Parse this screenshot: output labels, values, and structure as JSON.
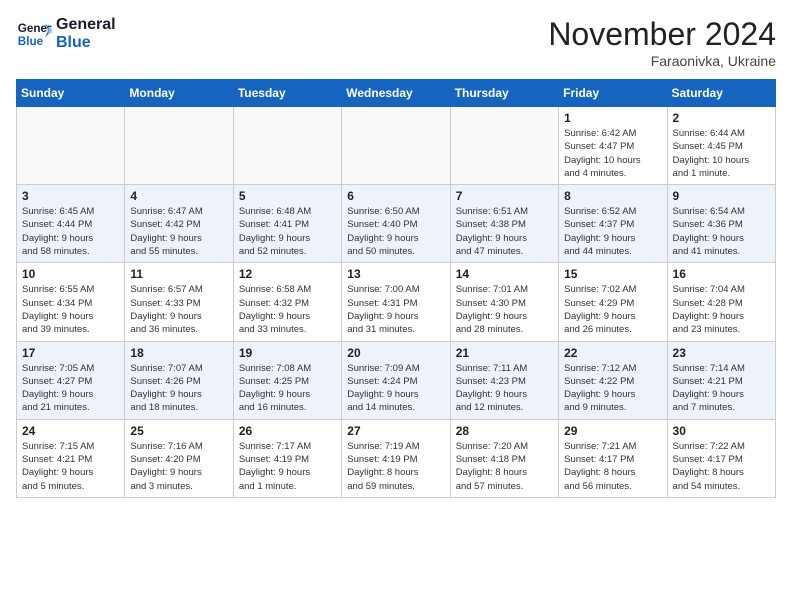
{
  "header": {
    "logo_line1": "General",
    "logo_line2": "Blue",
    "month_title": "November 2024",
    "location": "Faraonivka, Ukraine"
  },
  "weekdays": [
    "Sunday",
    "Monday",
    "Tuesday",
    "Wednesday",
    "Thursday",
    "Friday",
    "Saturday"
  ],
  "weeks": [
    [
      {
        "day": "",
        "info": ""
      },
      {
        "day": "",
        "info": ""
      },
      {
        "day": "",
        "info": ""
      },
      {
        "day": "",
        "info": ""
      },
      {
        "day": "",
        "info": ""
      },
      {
        "day": "1",
        "info": "Sunrise: 6:42 AM\nSunset: 4:47 PM\nDaylight: 10 hours\nand 4 minutes."
      },
      {
        "day": "2",
        "info": "Sunrise: 6:44 AM\nSunset: 4:45 PM\nDaylight: 10 hours\nand 1 minute."
      }
    ],
    [
      {
        "day": "3",
        "info": "Sunrise: 6:45 AM\nSunset: 4:44 PM\nDaylight: 9 hours\nand 58 minutes."
      },
      {
        "day": "4",
        "info": "Sunrise: 6:47 AM\nSunset: 4:42 PM\nDaylight: 9 hours\nand 55 minutes."
      },
      {
        "day": "5",
        "info": "Sunrise: 6:48 AM\nSunset: 4:41 PM\nDaylight: 9 hours\nand 52 minutes."
      },
      {
        "day": "6",
        "info": "Sunrise: 6:50 AM\nSunset: 4:40 PM\nDaylight: 9 hours\nand 50 minutes."
      },
      {
        "day": "7",
        "info": "Sunrise: 6:51 AM\nSunset: 4:38 PM\nDaylight: 9 hours\nand 47 minutes."
      },
      {
        "day": "8",
        "info": "Sunrise: 6:52 AM\nSunset: 4:37 PM\nDaylight: 9 hours\nand 44 minutes."
      },
      {
        "day": "9",
        "info": "Sunrise: 6:54 AM\nSunset: 4:36 PM\nDaylight: 9 hours\nand 41 minutes."
      }
    ],
    [
      {
        "day": "10",
        "info": "Sunrise: 6:55 AM\nSunset: 4:34 PM\nDaylight: 9 hours\nand 39 minutes."
      },
      {
        "day": "11",
        "info": "Sunrise: 6:57 AM\nSunset: 4:33 PM\nDaylight: 9 hours\nand 36 minutes."
      },
      {
        "day": "12",
        "info": "Sunrise: 6:58 AM\nSunset: 4:32 PM\nDaylight: 9 hours\nand 33 minutes."
      },
      {
        "day": "13",
        "info": "Sunrise: 7:00 AM\nSunset: 4:31 PM\nDaylight: 9 hours\nand 31 minutes."
      },
      {
        "day": "14",
        "info": "Sunrise: 7:01 AM\nSunset: 4:30 PM\nDaylight: 9 hours\nand 28 minutes."
      },
      {
        "day": "15",
        "info": "Sunrise: 7:02 AM\nSunset: 4:29 PM\nDaylight: 9 hours\nand 26 minutes."
      },
      {
        "day": "16",
        "info": "Sunrise: 7:04 AM\nSunset: 4:28 PM\nDaylight: 9 hours\nand 23 minutes."
      }
    ],
    [
      {
        "day": "17",
        "info": "Sunrise: 7:05 AM\nSunset: 4:27 PM\nDaylight: 9 hours\nand 21 minutes."
      },
      {
        "day": "18",
        "info": "Sunrise: 7:07 AM\nSunset: 4:26 PM\nDaylight: 9 hours\nand 18 minutes."
      },
      {
        "day": "19",
        "info": "Sunrise: 7:08 AM\nSunset: 4:25 PM\nDaylight: 9 hours\nand 16 minutes."
      },
      {
        "day": "20",
        "info": "Sunrise: 7:09 AM\nSunset: 4:24 PM\nDaylight: 9 hours\nand 14 minutes."
      },
      {
        "day": "21",
        "info": "Sunrise: 7:11 AM\nSunset: 4:23 PM\nDaylight: 9 hours\nand 12 minutes."
      },
      {
        "day": "22",
        "info": "Sunrise: 7:12 AM\nSunset: 4:22 PM\nDaylight: 9 hours\nand 9 minutes."
      },
      {
        "day": "23",
        "info": "Sunrise: 7:14 AM\nSunset: 4:21 PM\nDaylight: 9 hours\nand 7 minutes."
      }
    ],
    [
      {
        "day": "24",
        "info": "Sunrise: 7:15 AM\nSunset: 4:21 PM\nDaylight: 9 hours\nand 5 minutes."
      },
      {
        "day": "25",
        "info": "Sunrise: 7:16 AM\nSunset: 4:20 PM\nDaylight: 9 hours\nand 3 minutes."
      },
      {
        "day": "26",
        "info": "Sunrise: 7:17 AM\nSunset: 4:19 PM\nDaylight: 9 hours\nand 1 minute."
      },
      {
        "day": "27",
        "info": "Sunrise: 7:19 AM\nSunset: 4:19 PM\nDaylight: 8 hours\nand 59 minutes."
      },
      {
        "day": "28",
        "info": "Sunrise: 7:20 AM\nSunset: 4:18 PM\nDaylight: 8 hours\nand 57 minutes."
      },
      {
        "day": "29",
        "info": "Sunrise: 7:21 AM\nSunset: 4:17 PM\nDaylight: 8 hours\nand 56 minutes."
      },
      {
        "day": "30",
        "info": "Sunrise: 7:22 AM\nSunset: 4:17 PM\nDaylight: 8 hours\nand 54 minutes."
      }
    ]
  ]
}
